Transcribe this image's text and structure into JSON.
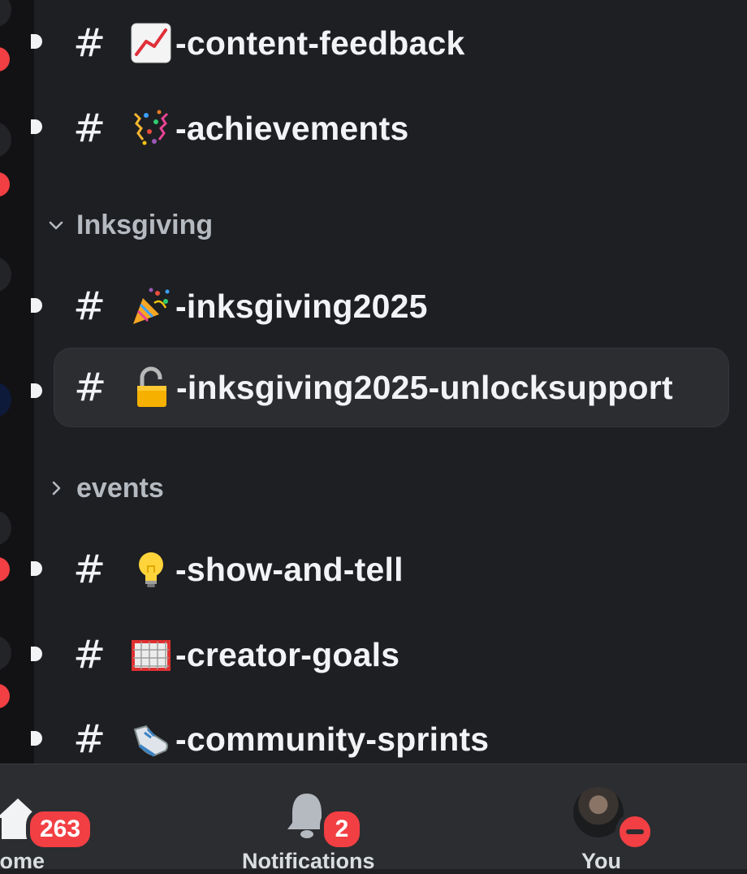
{
  "sidebar": {
    "channels_top": [
      {
        "name": "-content-feedback",
        "emoji": "chart-increasing-icon"
      },
      {
        "name": "-achievements",
        "emoji": "confetti-icon"
      }
    ],
    "categories": [
      {
        "label": "Inksgiving",
        "expanded": true,
        "channels": [
          {
            "name": "-inksgiving2025",
            "emoji": "party-popper-icon"
          },
          {
            "name": "-inksgiving2025-unlocksupport",
            "emoji": "unlocked-padlock-icon",
            "selected": true
          }
        ]
      },
      {
        "label": "events",
        "expanded": false,
        "channels": [
          {
            "name": "-show-and-tell",
            "emoji": "lightbulb-icon"
          },
          {
            "name": "-creator-goals",
            "emoji": "goal-net-icon"
          },
          {
            "name": "-community-sprints",
            "emoji": "running-shoe-icon"
          }
        ]
      }
    ],
    "hash_symbol": "#"
  },
  "tabbar": {
    "home": {
      "label": "Home",
      "badge": "263"
    },
    "notifications": {
      "label": "Notifications",
      "badge": "2"
    },
    "you": {
      "label": "You",
      "status": "do-not-disturb"
    }
  },
  "colors": {
    "background": "#1e1f23",
    "rail": "#121214",
    "selected": "#2b2d31",
    "badge": "#f23f43",
    "text": "#f2f3f5",
    "muted": "#b5bac1"
  }
}
